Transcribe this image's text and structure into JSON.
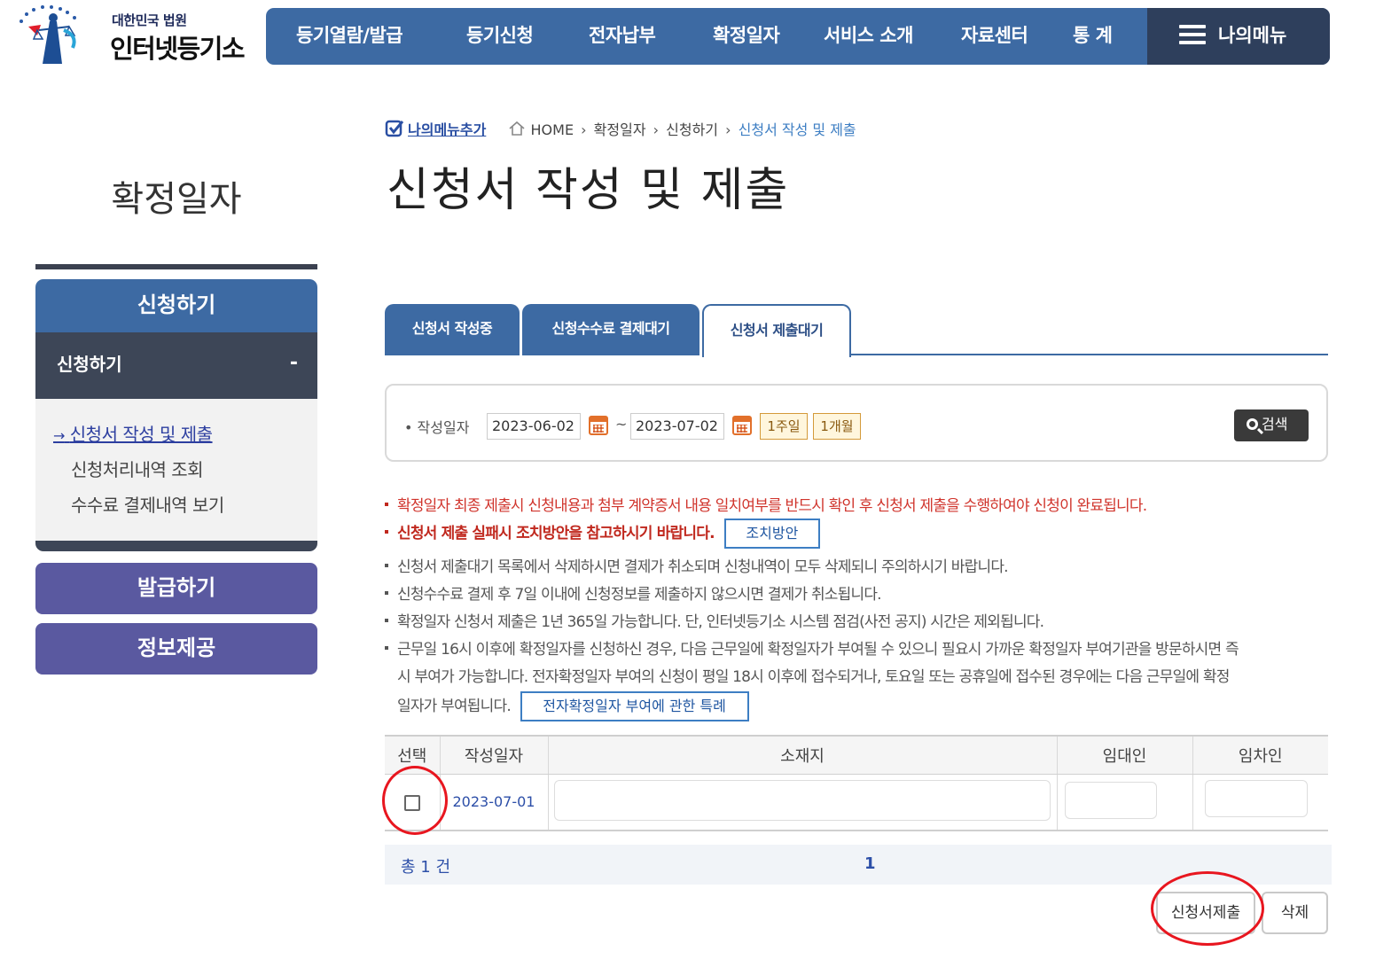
{
  "header": {
    "court_name": "대한민국 법원",
    "site_name": "인터넷등기소",
    "nav": [
      "등기열람/발급",
      "등기신청",
      "전자납부",
      "확정일자",
      "서비스 소개",
      "자료센터",
      "통 계"
    ],
    "my_menu": "나의메뉴"
  },
  "breadcrumb": {
    "add_menu": "나의메뉴추가",
    "items": [
      "HOME",
      "확정일자",
      "신청하기",
      "신청서 작성 및 제출"
    ]
  },
  "page_title": "신청서 작성 및 제출",
  "sidebar": {
    "title": "확정일자",
    "head": "신청하기",
    "sub": "신청하기",
    "sub_toggle": "-",
    "items": [
      "신청서 작성 및 제출",
      "신청처리내역 조회",
      "수수료 결제내역 보기"
    ],
    "buttons": [
      "발급하기",
      "정보제공"
    ]
  },
  "tabs": [
    "신청서 작성중",
    "신청수수료 결제대기",
    "신청서 제출대기"
  ],
  "active_tab": 2,
  "search": {
    "label": "작성일자",
    "from": "2023-06-02",
    "tilde": "~",
    "to": "2023-07-02",
    "periods": [
      "1주일",
      "1개월"
    ],
    "button": "검색"
  },
  "notices": {
    "n1": "확정일자 최종 제출시 신청내용과 첨부 계약증서 내용 일치여부를 반드시 확인 후 신청서 제출을 수행하여야 신청이 완료됩니다.",
    "n2": "신청서 제출 실패시 조치방안을 참고하시기 바랍니다.",
    "n2_button": "조치방안",
    "n3": "신청서 제출대기 목록에서 삭제하시면 결제가 취소되며 신청내역이 모두 삭제되니 주의하시기 바랍니다.",
    "n4": "신청수수료 결제 후 7일 이내에 신청정보를 제출하지 않으시면 결제가 취소됩니다.",
    "n5": "확정일자 신청서 제출은 1년 365일 가능합니다. 단, 인터넷등기소 시스템 점검(사전 공지) 시간은 제외됩니다.",
    "n6_line1": "근무일 16시 이후에 확정일자를 신청하신 경우, 다음 근무일에 확정일자가 부여될 수 있으니 필요시 가까운 확정일자 부여기관을 방문하시면 즉",
    "n6_line2": "시 부여가 가능합니다. 전자확정일자 부여의 신청이 평일 18시 이후에 접수되거나, 토요일 또는 공휴일에 접수된 경우에는 다음 근무일에 확정",
    "n6_line3": "일자가 부여됩니다.",
    "n6_button": "전자확정일자 부여에 관한 특례"
  },
  "table": {
    "headers": [
      "선택",
      "작성일자",
      "소재지",
      "임대인",
      "임차인"
    ],
    "rows": [
      {
        "date": "2023-07-01",
        "address": "",
        "lessor": "",
        "lessee": ""
      }
    ]
  },
  "footer": {
    "total": "총 1 건",
    "page": "1"
  },
  "actions": {
    "submit": "신청서제출",
    "delete": "삭제"
  },
  "colors": {
    "nav_blue": "#3d6aa3",
    "nav_dark": "#2e3f5c",
    "side_purple": "#5a59a0",
    "notice_red": "#d0342c",
    "annotation_red": "#e8161f"
  }
}
